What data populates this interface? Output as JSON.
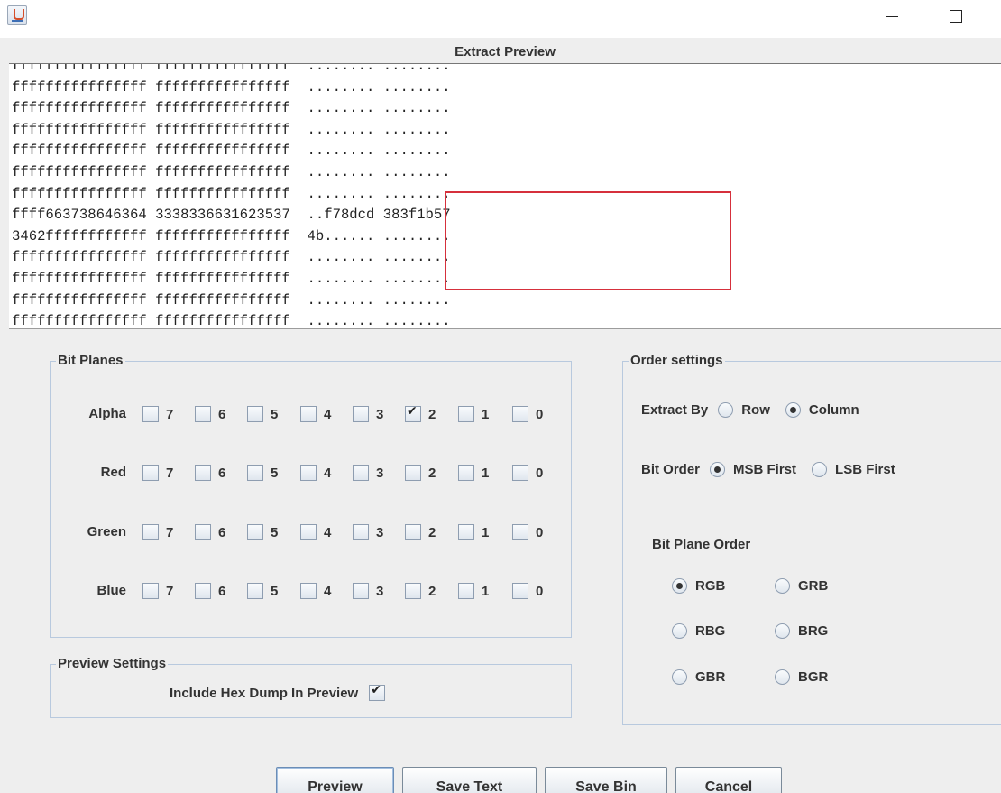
{
  "window": {
    "icon": "java-cup-icon",
    "minimize_icon": "minimize-icon",
    "maximize_icon": "maximize-icon"
  },
  "preview": {
    "title": "Extract Preview",
    "lines": [
      "ffffffffffffffff ffffffffffffffff  ........ ........",
      "ffffffffffffffff ffffffffffffffff  ........ ........",
      "ffffffffffffffff ffffffffffffffff  ........ ........",
      "ffffffffffffffff ffffffffffffffff  ........ ........",
      "ffffffffffffffff ffffffffffffffff  ........ ........",
      "ffffffffffffffff ffffffffffffffff  ........ ........",
      "ffffffffffffffff ffffffffffffffff  ........ ........",
      "ffff663738646364 3338336631623537  ..f78dcd 383f1b57",
      "3462ffffffffffff ffffffffffffffff  4b...... ........",
      "ffffffffffffffff ffffffffffffffff  ........ ........",
      "ffffffffffffffff ffffffffffffffff  ........ ........",
      "ffffffffffffffff ffffffffffffffff  ........ ........",
      "ffffffffffffffff ffffffffffffffff  ........ ........"
    ],
    "highlight_color": "#d6303c"
  },
  "bit_planes": {
    "title": "Bit Planes",
    "bits": [
      "7",
      "6",
      "5",
      "4",
      "3",
      "2",
      "1",
      "0"
    ],
    "rows": [
      {
        "label": "Alpha",
        "checked": [
          false,
          false,
          false,
          false,
          false,
          true,
          false,
          false
        ]
      },
      {
        "label": "Red",
        "checked": [
          false,
          false,
          false,
          false,
          false,
          false,
          false,
          false
        ]
      },
      {
        "label": "Green",
        "checked": [
          false,
          false,
          false,
          false,
          false,
          false,
          false,
          false
        ]
      },
      {
        "label": "Blue",
        "checked": [
          false,
          false,
          false,
          false,
          false,
          false,
          false,
          false
        ]
      }
    ]
  },
  "preview_settings": {
    "title": "Preview Settings",
    "hex_dump_label": "Include Hex Dump In Preview",
    "hex_dump_checked": true
  },
  "order_settings": {
    "title": "Order settings",
    "extract_by_label": "Extract By",
    "row_label": "Row",
    "column_label": "Column",
    "extract_by_selected": "Column",
    "bit_order_label": "Bit Order",
    "msb_label": "MSB First",
    "lsb_label": "LSB First",
    "bit_order_selected": "MSB First",
    "plane_order_label": "Bit Plane Order",
    "plane_orders": [
      "RGB",
      "GRB",
      "RBG",
      "BRG",
      "GBR",
      "BGR"
    ],
    "plane_order_selected": "RGB"
  },
  "buttons": {
    "preview": "Preview",
    "save_text": "Save Text",
    "save_bin": "Save Bin",
    "cancel": "Cancel"
  }
}
